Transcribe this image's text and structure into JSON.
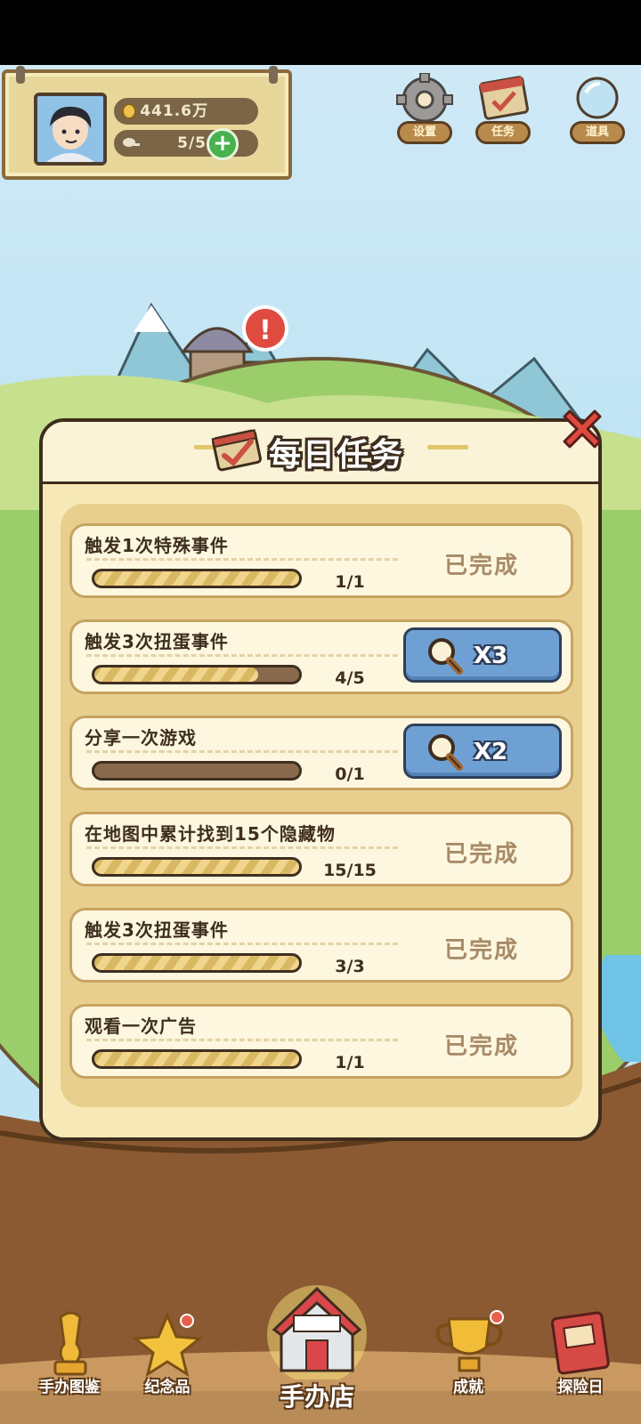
{
  "profile": {
    "coins": "441.6万",
    "energy": "5/5"
  },
  "top_icons": [
    {
      "name": "settings",
      "label": "设置"
    },
    {
      "name": "tasks",
      "label": "任务"
    },
    {
      "name": "tools",
      "label": "道具"
    }
  ],
  "dialog": {
    "title": "每日任务",
    "tasks": [
      {
        "name": "触发1次特殊事件",
        "progress": "1/1",
        "fraction": 1.0,
        "status": "done",
        "status_label": "已完成"
      },
      {
        "name": "触发3次扭蛋事件",
        "progress": "4/5",
        "fraction": 0.8,
        "status": "reward",
        "reward_label": "X3"
      },
      {
        "name": "分享一次游戏",
        "progress": "0/1",
        "fraction": 0.0,
        "status": "reward",
        "reward_label": "X2"
      },
      {
        "name": "在地图中累计找到15个隐藏物",
        "progress": "15/15",
        "fraction": 1.0,
        "status": "done",
        "status_label": "已完成"
      },
      {
        "name": "触发3次扭蛋事件",
        "progress": "3/3",
        "fraction": 1.0,
        "status": "done",
        "status_label": "已完成"
      },
      {
        "name": "观看一次广告",
        "progress": "1/1",
        "fraction": 1.0,
        "status": "done",
        "status_label": "已完成"
      }
    ]
  },
  "bottom_nav": [
    {
      "name": "handcraft-collection",
      "label": "手办图鉴"
    },
    {
      "name": "commemorative",
      "label": "纪念品"
    },
    {
      "name": "shop",
      "label": "手办店"
    },
    {
      "name": "achievement",
      "label": "成就"
    },
    {
      "name": "diary",
      "label": "探险日"
    }
  ],
  "colors": {
    "panel": "#f7e9b7",
    "outline": "#3e2d1e",
    "reward_button": "#6fa0d4",
    "done_text": "#a88b67"
  }
}
